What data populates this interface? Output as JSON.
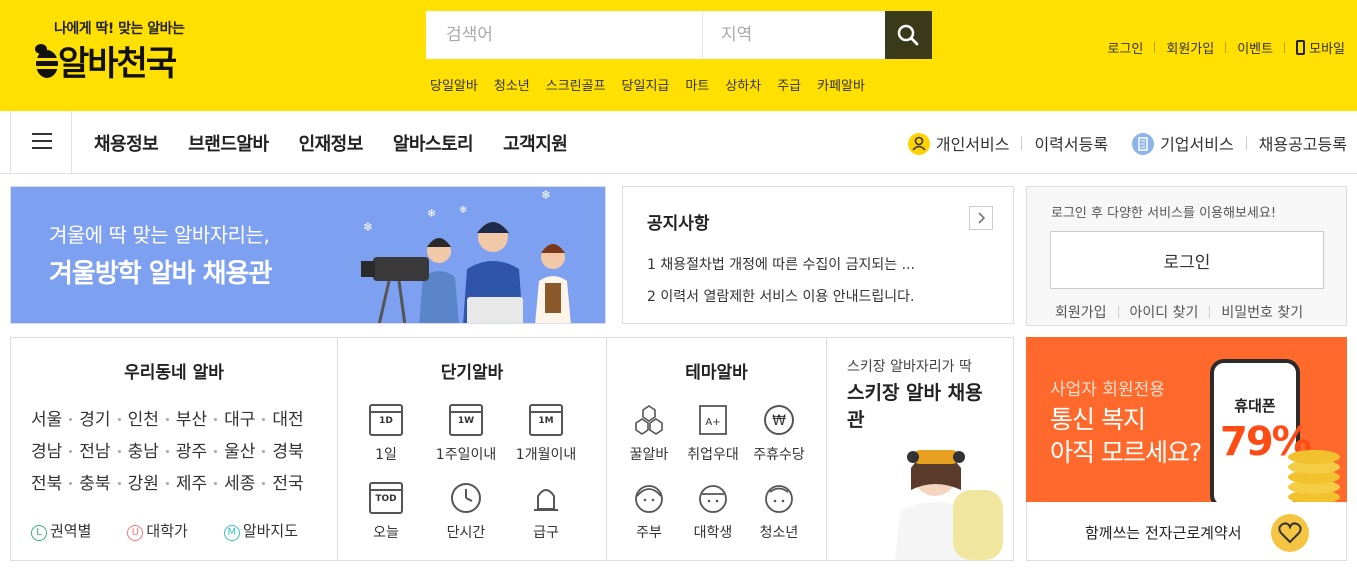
{
  "header": {
    "slogan": "나에게 딱! 맞는 알바는",
    "logo_text": "알바천국",
    "search": {
      "keyword_placeholder": "검색어",
      "region_placeholder": "지역"
    },
    "hot_keywords": [
      "당일알바",
      "청소년",
      "스크린골프",
      "당일지급",
      "마트",
      "상하차",
      "주급",
      "카페알바"
    ],
    "util_links": {
      "login": "로그인",
      "signup": "회원가입",
      "event": "이벤트",
      "mobile": "모바일"
    }
  },
  "nav": {
    "menu": [
      "채용정보",
      "브랜드알바",
      "인재정보",
      "알바스토리",
      "고객지원"
    ],
    "personal_service": "개인서비스",
    "resume_register": "이력서등록",
    "corporate_service": "기업서비스",
    "job_post_register": "채용공고등록"
  },
  "banner": {
    "sub": "겨울에 딱 맞는 알바자리는,",
    "title": "겨울방학 알바 채용관"
  },
  "notice": {
    "title": "공지사항",
    "items": [
      "1 채용절차법 개정에 따른 수집이 금지되는 ...",
      "2 이력서 열람제한 서비스 이용 안내드립니다."
    ]
  },
  "login_panel": {
    "message": "로그인 후 다양한 서비스를 이용해보세요!",
    "button": "로그인",
    "signup": "회원가입",
    "find_id": "아이디 찾기",
    "find_pw": "비밀번호 찾기"
  },
  "neighborhood": {
    "title": "우리동네 알바",
    "rows": [
      [
        "서울",
        "경기",
        "인천",
        "부산",
        "대구",
        "대전"
      ],
      [
        "경남",
        "전남",
        "충남",
        "광주",
        "울산",
        "경북"
      ],
      [
        "전북",
        "충북",
        "강원",
        "제주",
        "세종",
        "전국"
      ]
    ],
    "links": [
      {
        "icon": "L",
        "label": "권역별",
        "color": "#3cb371"
      },
      {
        "icon": "U",
        "label": "대학가",
        "color": "#f07a7a"
      },
      {
        "icon": "M",
        "label": "알바지도",
        "color": "#3cc0c8"
      }
    ]
  },
  "short_term": {
    "title": "단기알바",
    "items": [
      {
        "icon": "1D",
        "label": "1일"
      },
      {
        "icon": "1W",
        "label": "1주일이내"
      },
      {
        "icon": "1M",
        "label": "1개월이내"
      },
      {
        "icon": "TOD",
        "label": "오늘"
      },
      {
        "icon": "clock-icon",
        "label": "단시간"
      },
      {
        "icon": "urgent-siren-icon",
        "label": "급구"
      }
    ]
  },
  "theme": {
    "title": "테마알바",
    "items": [
      {
        "icon": "honeycomb-icon",
        "label": "꿀알바"
      },
      {
        "icon": "a-plus-icon",
        "label": "취업우대"
      },
      {
        "icon": "won-icon",
        "label": "주휴수당"
      },
      {
        "icon": "housewife-face-icon",
        "label": "주부"
      },
      {
        "icon": "student-face-icon",
        "label": "대학생"
      },
      {
        "icon": "teen-face-icon",
        "label": "청소년"
      }
    ]
  },
  "ski_promo": {
    "sub": "스키장 알바자리가 딱",
    "title": "스키장 알바 채용관"
  },
  "telecom_ad": {
    "label": "사업자 회원전용",
    "title_line1": "통신 복지",
    "title_line2": "아직 모르세요?",
    "phone_label": "휴대폰",
    "percent": "79%"
  },
  "contract_ad": {
    "text": "함께쓰는 전자근로계약서"
  },
  "colors": {
    "brand_yellow": "#ffe000",
    "search_button": "#3a3a1a",
    "banner_blue": "#7ea0f0",
    "ad_orange": "#ff6a2c"
  }
}
